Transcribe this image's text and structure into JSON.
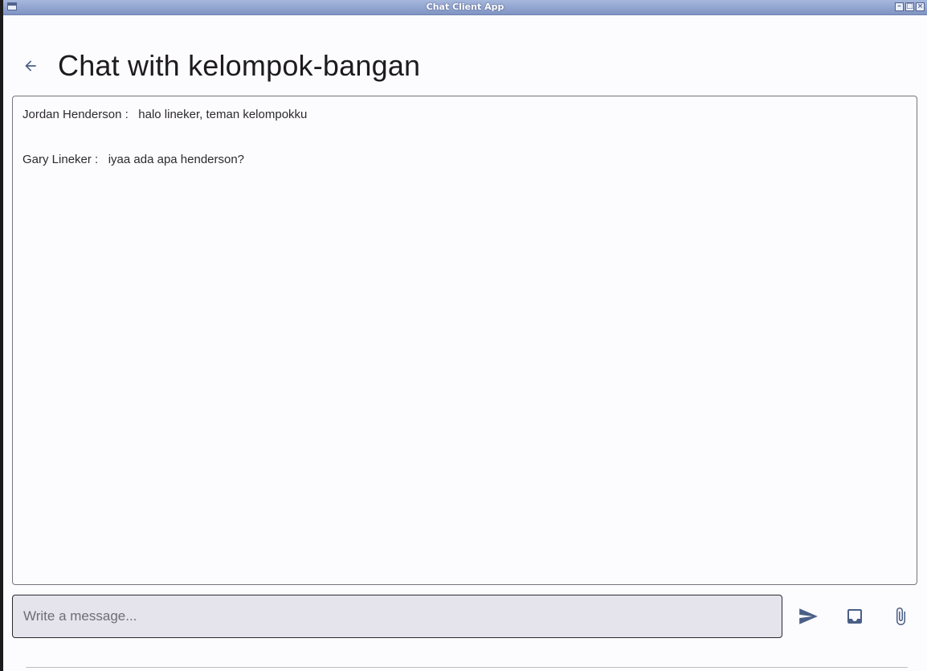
{
  "window": {
    "title": "Chat Client App",
    "controls": [
      "minimize",
      "maximize",
      "close"
    ]
  },
  "header": {
    "back_icon": "arrow-left-icon",
    "title": "Chat with kelompok-bangan"
  },
  "messages": [
    {
      "sender": "Jordan Henderson",
      "separator": " :   ",
      "text": "halo lineker, teman kelompokku"
    },
    {
      "sender": "Gary Lineker",
      "separator": " :   ",
      "text": "iyaa ada apa henderson?"
    }
  ],
  "composer": {
    "placeholder": "Write a message...",
    "value": "",
    "send_icon": "send-icon",
    "inbox_icon": "inbox-icon",
    "attach_icon": "paperclip-icon"
  },
  "colors": {
    "accent": "#4a5f86",
    "background": "#fcfbfe",
    "input_background": "#e5e3ec",
    "titlebar": "#8fa2d0"
  }
}
